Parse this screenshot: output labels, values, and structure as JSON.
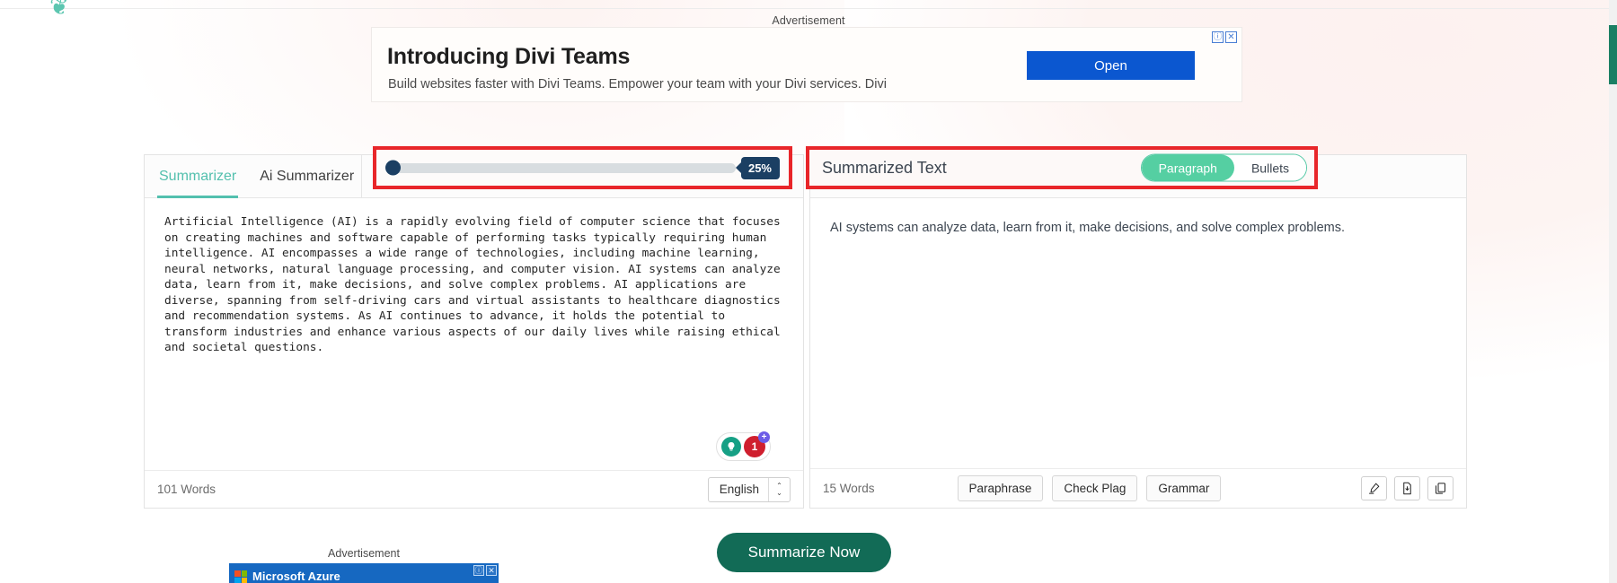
{
  "brand": {
    "logo_glyph": "❦"
  },
  "ads": {
    "top": {
      "label": "Advertisement",
      "title": "Introducing Divi Teams",
      "subtitle": "Build websites faster with Divi Teams. Empower your team with your Divi services. Divi",
      "cta": "Open",
      "info_badge": "ⓘ",
      "close_badge": "✕"
    },
    "bottom": {
      "label": "Advertisement",
      "text": "Microsoft Azure",
      "info_badge": "ⓘ",
      "close_badge": "✕"
    }
  },
  "left_panel": {
    "tabs": [
      {
        "label": "Summarizer",
        "active": true
      },
      {
        "label": "Ai Summarizer",
        "active": false
      }
    ],
    "slider": {
      "value_label": "25%",
      "value": 25,
      "min": 0,
      "max": 100,
      "fill_color": "#d8dde0",
      "thumb_color": "#1b3f63",
      "badge_color": "#1b3f63"
    },
    "editor_text": "Artificial Intelligence (AI) is a rapidly evolving field of computer science that focuses on creating machines and software capable of performing tasks typically requiring human intelligence. AI encompasses a wide range of technologies, including machine learning, neural networks, natural language processing, and computer vision. AI systems can analyze data, learn from it, make decisions, and solve complex problems. AI applications are diverse, spanning from self-driving cars and virtual assistants to healthcare diagnostics and recommendation systems. As AI continues to advance, it holds the potential to transform industries and enhance various aspects of our daily lives while raising ethical and societal questions.",
    "floating": {
      "bulb_icon": "lightbulb-icon",
      "bulb_glyph": "💡",
      "issue_count": "1",
      "plus_glyph": "+"
    },
    "footer": {
      "word_count": "101 Words",
      "language": "English",
      "up_glyph": "⌃",
      "down_glyph": "⌄"
    }
  },
  "right_panel": {
    "title": "Summarized Text",
    "segments": [
      {
        "label": "Paragraph",
        "active": true
      },
      {
        "label": "Bullets",
        "active": false
      }
    ],
    "summary_text": "AI systems can analyze data, learn from it, make decisions, and solve complex problems.",
    "footer": {
      "word_count": "15 Words",
      "actions": [
        "Paraphrase",
        "Check Plag",
        "Grammar"
      ],
      "icons": [
        "highlighter-icon",
        "download-icon",
        "copy-icon"
      ]
    }
  },
  "primary_action": {
    "label": "Summarize Now"
  },
  "colors": {
    "accent_teal": "#53c0ae",
    "segment_green": "#55cfa2",
    "highlight_red": "#e8262a",
    "dark_navy": "#1b3f63",
    "button_green": "#126b56"
  }
}
